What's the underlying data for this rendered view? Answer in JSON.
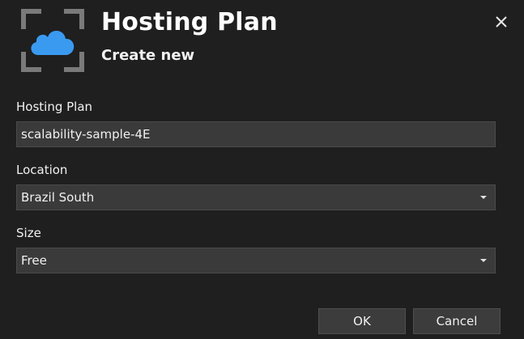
{
  "header": {
    "icon": "cloud-resource-icon",
    "title": "Hosting Plan",
    "subtitle": "Create new"
  },
  "close_icon": "close-icon",
  "form": {
    "hosting_plan": {
      "label": "Hosting Plan",
      "value": "scalability-sample-4E"
    },
    "location": {
      "label": "Location",
      "value": "Brazil South"
    },
    "size": {
      "label": "Size",
      "value": "Free"
    }
  },
  "buttons": {
    "ok_label": "OK",
    "cancel_label": "Cancel"
  },
  "colors": {
    "background": "#1f1f1f",
    "field_background": "#3a3a3a",
    "cloud_accent": "#3a9af0",
    "frame_gray": "#7a7a7a"
  }
}
